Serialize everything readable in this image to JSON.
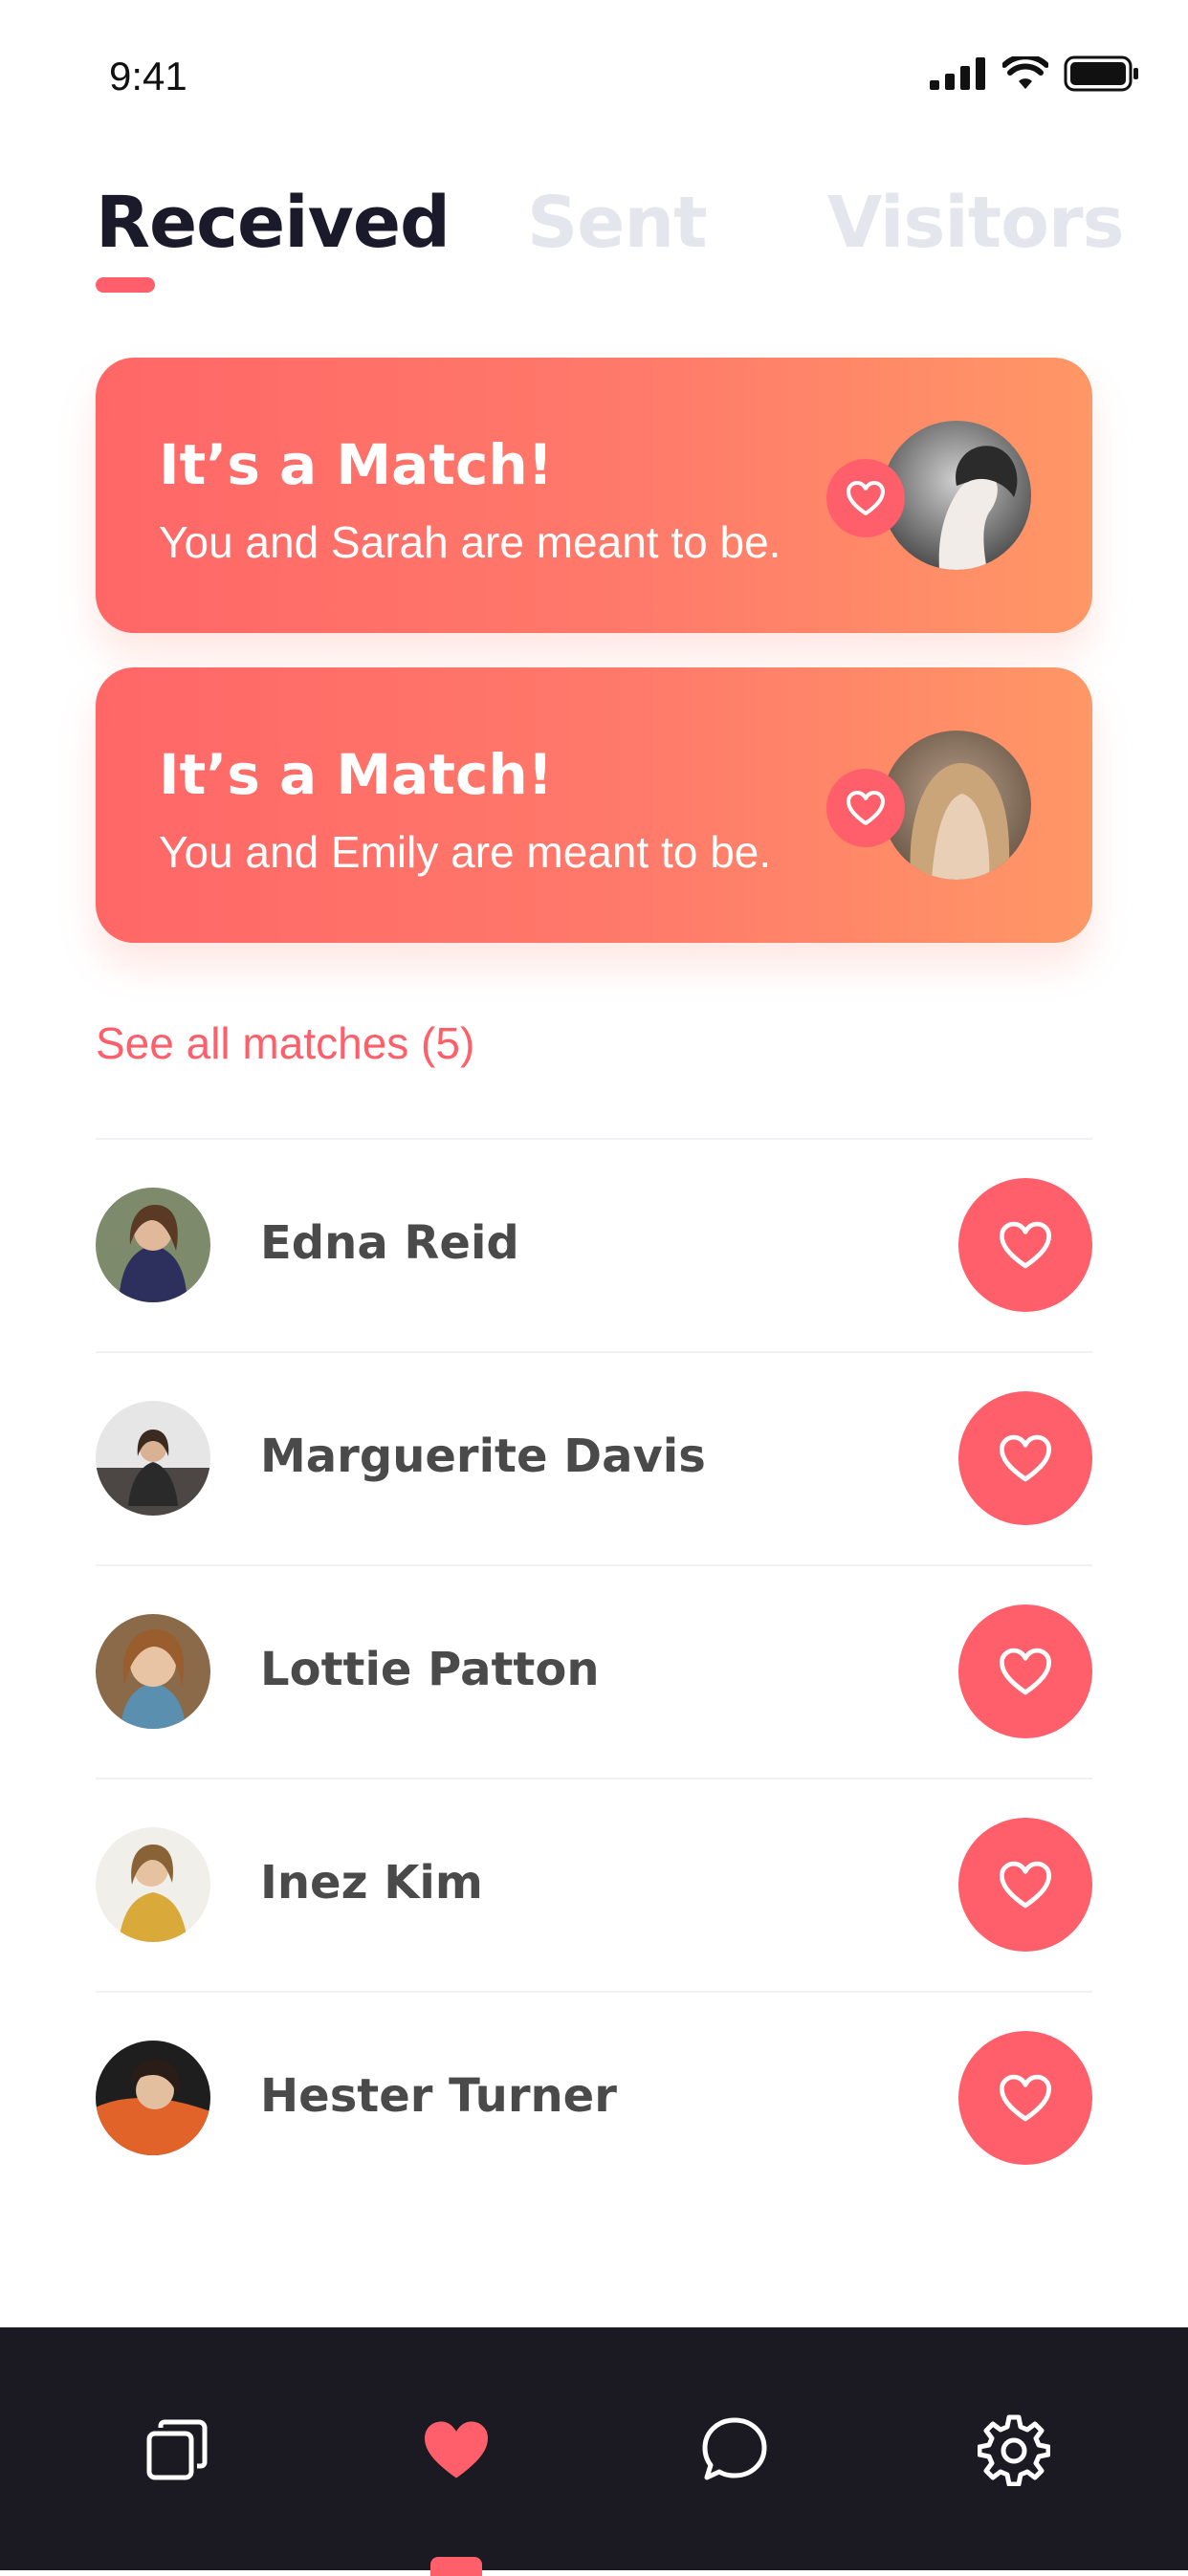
{
  "status_bar": {
    "time": "9:41"
  },
  "tabs": [
    {
      "label": "Received",
      "active": true
    },
    {
      "label": "Sent",
      "active": false
    },
    {
      "label": "Visitors",
      "active": false
    }
  ],
  "matches": [
    {
      "title": "It’s a Match!",
      "subtitle": "You and Sarah are meant to be."
    },
    {
      "title": "It’s a Match!",
      "subtitle": "You and Emily are meant to be."
    }
  ],
  "see_all_label": "See all matches (5)",
  "list": [
    {
      "name": "Edna Reid"
    },
    {
      "name": "Marguerite Davis"
    },
    {
      "name": "Lottie Patton"
    },
    {
      "name": "Inez Kim"
    },
    {
      "name": "Hester Turner"
    }
  ],
  "nav": {
    "items": [
      "cards-icon",
      "heart-icon",
      "chat-icon",
      "gear-icon"
    ],
    "active_index": 1
  },
  "colors": {
    "accent": "#ff5f6a",
    "card_gradient_start": "#ff6767",
    "card_gradient_end": "#ff9766",
    "tab_inactive": "#e4e6ee",
    "nav_background": "#1b1a22"
  }
}
